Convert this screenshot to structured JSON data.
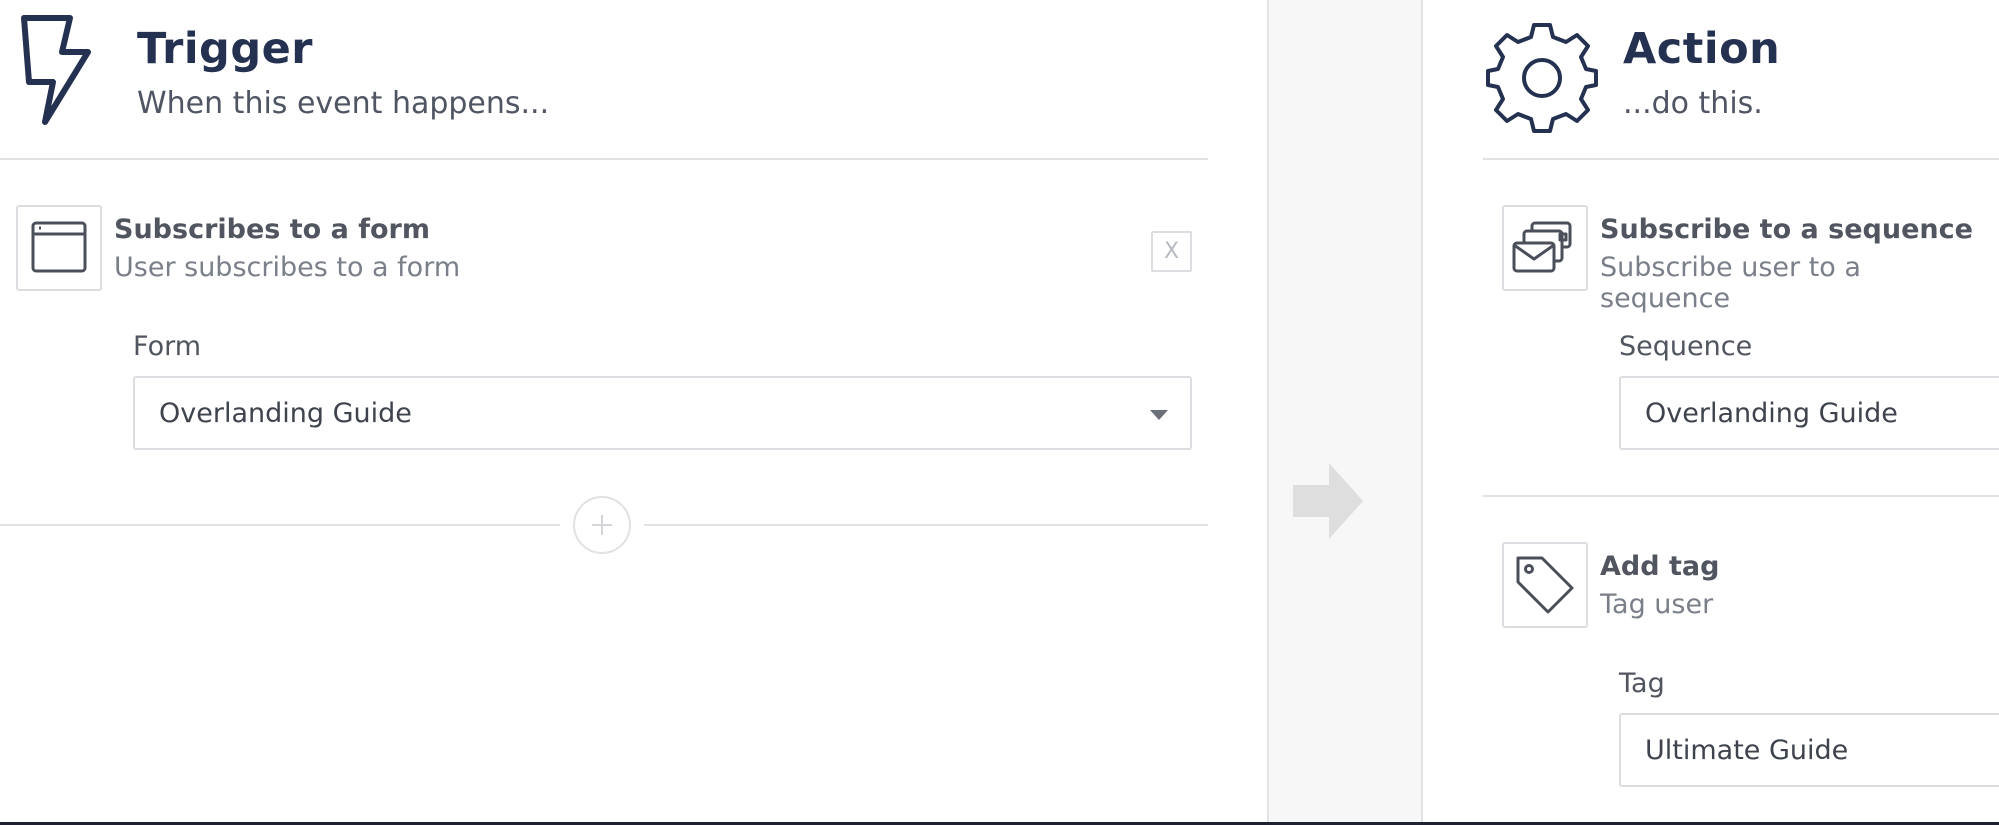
{
  "trigger": {
    "icon": "lightning-icon",
    "title": "Trigger",
    "subtitle": "When this event happens...",
    "item": {
      "icon": "browser-window-icon",
      "title": "Subscribes to a form",
      "subtitle": "User subscribes to a form",
      "remove_label": "X"
    },
    "field": {
      "label": "Form",
      "value": "Overlanding Guide"
    },
    "add_icon": "plus-icon"
  },
  "flow": {
    "icon": "arrow-right-icon"
  },
  "action": {
    "icon": "gear-icon",
    "title": "Action",
    "subtitle": "...do this.",
    "items": [
      {
        "icon": "email-sequence-icon",
        "title": "Subscribe to a sequence",
        "subtitle": "Subscribe user to a sequence",
        "field_label": "Sequence",
        "field_value": "Overlanding Guide"
      },
      {
        "icon": "tag-icon",
        "title": "Add tag",
        "subtitle": "Tag user",
        "field_label": "Tag",
        "field_value": "Ultimate Guide"
      }
    ]
  },
  "colors": {
    "heading": "#243150",
    "border": "#dcdde0",
    "gutter": "#f7f7f8",
    "arrow": "#dedede"
  }
}
